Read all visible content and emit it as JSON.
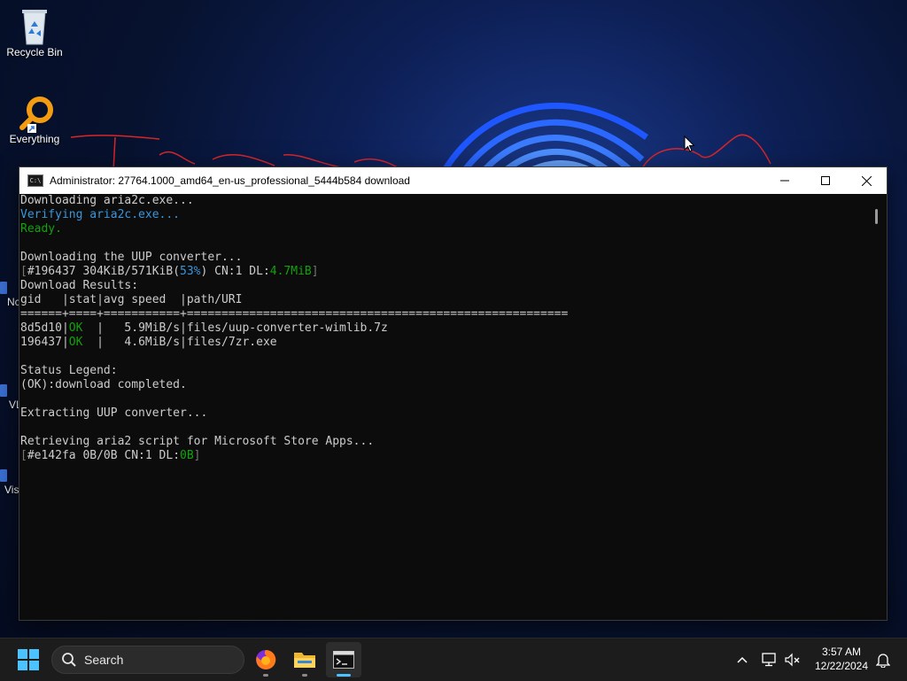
{
  "desktop": {
    "icons": [
      {
        "label": "Recycle Bin",
        "icon": "recycle-bin-icon"
      },
      {
        "label": "Everything",
        "icon": "everything-search-icon"
      }
    ],
    "partial_icons": [
      "Nc",
      "VL",
      "Visi"
    ]
  },
  "console_window": {
    "title": "Administrator:  27764.1000_amd64_en-us_professional_5444b584 download",
    "lines": [
      [
        {
          "t": "Downloading aria2c.exe...",
          "c": ""
        }
      ],
      [
        {
          "t": "Verifying aria2c.exe...",
          "c": "cyan"
        }
      ],
      [
        {
          "t": "Ready.",
          "c": "green"
        }
      ],
      [
        {
          "t": "",
          "c": ""
        }
      ],
      [
        {
          "t": "Downloading the UUP converter...",
          "c": ""
        }
      ],
      [
        {
          "t": "[",
          "c": "dim"
        },
        {
          "t": "#196437 304KiB/571KiB(",
          "c": ""
        },
        {
          "t": "53%",
          "c": "cyan"
        },
        {
          "t": ") CN:1 DL:",
          "c": ""
        },
        {
          "t": "4.7MiB",
          "c": "green"
        },
        {
          "t": "]",
          "c": "dim"
        }
      ],
      [
        {
          "t": "Download Results:",
          "c": ""
        }
      ],
      [
        {
          "t": "gid   |stat|avg speed  |path/URI",
          "c": ""
        }
      ],
      [
        {
          "t": "======+====+===========+=======================================================",
          "c": ""
        }
      ],
      [
        {
          "t": "8d5d10|",
          "c": ""
        },
        {
          "t": "OK",
          "c": "green"
        },
        {
          "t": "  |   5.9MiB/s|files/uup-converter-wimlib.7z",
          "c": ""
        }
      ],
      [
        {
          "t": "196437|",
          "c": ""
        },
        {
          "t": "OK",
          "c": "green"
        },
        {
          "t": "  |   4.6MiB/s|files/7zr.exe",
          "c": ""
        }
      ],
      [
        {
          "t": "",
          "c": ""
        }
      ],
      [
        {
          "t": "Status Legend:",
          "c": ""
        }
      ],
      [
        {
          "t": "(OK):download completed.",
          "c": ""
        }
      ],
      [
        {
          "t": "",
          "c": ""
        }
      ],
      [
        {
          "t": "Extracting UUP converter...",
          "c": ""
        }
      ],
      [
        {
          "t": "",
          "c": ""
        }
      ],
      [
        {
          "t": "Retrieving aria2 script for Microsoft Store Apps...",
          "c": ""
        }
      ],
      [
        {
          "t": "[",
          "c": "dim"
        },
        {
          "t": "#e142fa 0B/0B CN:1 DL:",
          "c": ""
        },
        {
          "t": "0B",
          "c": "green"
        },
        {
          "t": "]",
          "c": "dim"
        }
      ]
    ],
    "colors": {
      "cyan": "#3a96dd",
      "green": "#13a10e",
      "dim": "#767676",
      "text": "#cccccc",
      "background": "#0c0c0c"
    }
  },
  "taskbar": {
    "search_label": "Search",
    "apps": [
      "start-icon",
      "firefox-icon",
      "file-explorer-icon",
      "terminal-icon"
    ],
    "active_app": "terminal-icon",
    "time": "3:57 AM",
    "date": "12/22/2024",
    "accent": "#4cc2ff"
  }
}
